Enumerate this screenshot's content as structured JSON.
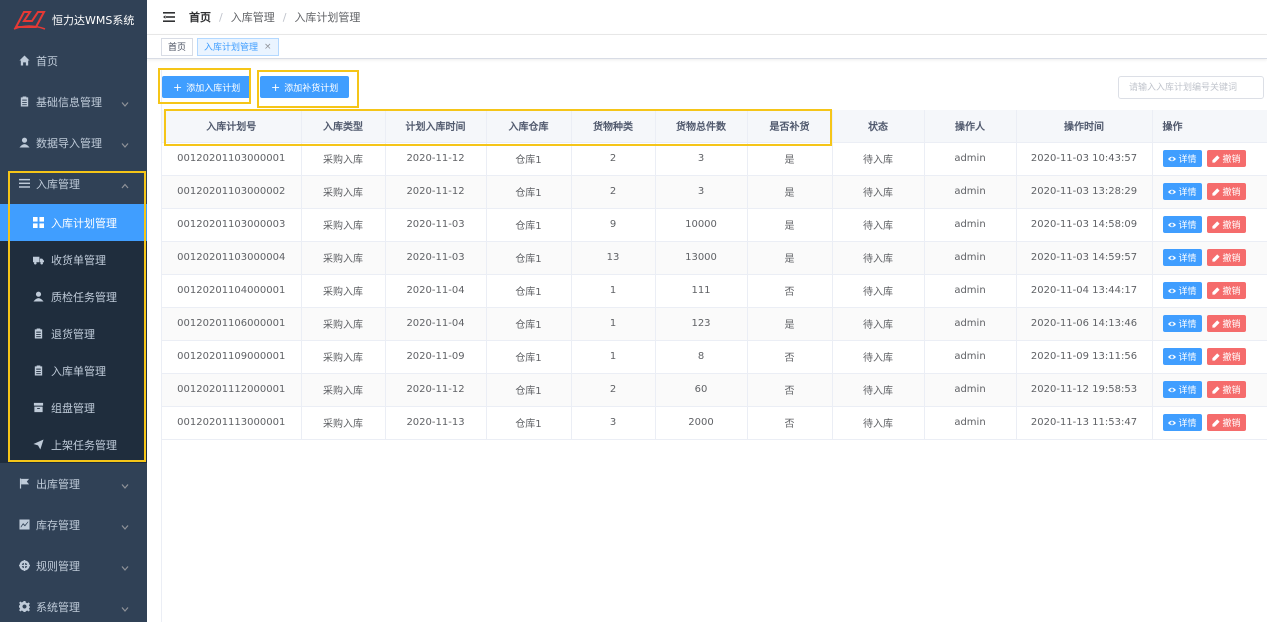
{
  "app": {
    "title": "恒力达WMS系统"
  },
  "sidebar": {
    "items_top": [
      {
        "label": "首页",
        "icon": "home-icon"
      },
      {
        "label": "基础信息管理",
        "icon": "clipboard-icon"
      },
      {
        "label": "数据导入管理",
        "icon": "user-icon"
      }
    ],
    "group": {
      "label": "入库管理",
      "icon": "list-icon",
      "children": [
        {
          "label": "入库计划管理",
          "icon": "grid-icon"
        },
        {
          "label": "收货单管理",
          "icon": "truck-icon"
        },
        {
          "label": "质检任务管理",
          "icon": "user-icon"
        },
        {
          "label": "退货管理",
          "icon": "clipboard-icon"
        },
        {
          "label": "入库单管理",
          "icon": "clipboard-icon"
        },
        {
          "label": "组盘管理",
          "icon": "box-icon"
        },
        {
          "label": "上架任务管理",
          "icon": "send-icon"
        }
      ]
    },
    "items_bottom": [
      {
        "label": "出库管理",
        "icon": "flag-icon"
      },
      {
        "label": "库存管理",
        "icon": "chart-icon"
      },
      {
        "label": "规则管理",
        "icon": "target-icon"
      },
      {
        "label": "系统管理",
        "icon": "gear-icon"
      }
    ]
  },
  "breadcrumb": [
    "首页",
    "入库管理",
    "入库计划管理"
  ],
  "tags": [
    {
      "label": "首页"
    },
    {
      "label": "入库计划管理",
      "close": "×"
    }
  ],
  "toolbar": {
    "add_plan": "添加入库计划",
    "add_replenish": "添加补货计划",
    "search_placeholder": "请输入入库计划编号关键词"
  },
  "table": {
    "headers": [
      "入库计划号",
      "入库类型",
      "计划入库时间",
      "入库仓库",
      "货物种类",
      "货物总件数",
      "是否补货",
      "状态",
      "操作人",
      "操作时间",
      "操作"
    ],
    "detail_label": "详情",
    "cancel_label": "撤销",
    "rows": [
      [
        "00120201103000001",
        "采购入库",
        "2020-11-12",
        "仓库1",
        "2",
        "3",
        "是",
        "待入库",
        "admin",
        "2020-11-03 10:43:57"
      ],
      [
        "00120201103000002",
        "采购入库",
        "2020-11-12",
        "仓库1",
        "2",
        "3",
        "是",
        "待入库",
        "admin",
        "2020-11-03 13:28:29"
      ],
      [
        "00120201103000003",
        "采购入库",
        "2020-11-03",
        "仓库1",
        "9",
        "10000",
        "是",
        "待入库",
        "admin",
        "2020-11-03 14:58:09"
      ],
      [
        "00120201103000004",
        "采购入库",
        "2020-11-03",
        "仓库1",
        "13",
        "13000",
        "是",
        "待入库",
        "admin",
        "2020-11-03 14:59:57"
      ],
      [
        "00120201104000001",
        "采购入库",
        "2020-11-04",
        "仓库1",
        "1",
        "111",
        "否",
        "待入库",
        "admin",
        "2020-11-04 13:44:17"
      ],
      [
        "00120201106000001",
        "采购入库",
        "2020-11-04",
        "仓库1",
        "1",
        "123",
        "是",
        "待入库",
        "admin",
        "2020-11-06 14:13:46"
      ],
      [
        "00120201109000001",
        "采购入库",
        "2020-11-09",
        "仓库1",
        "1",
        "8",
        "否",
        "待入库",
        "admin",
        "2020-11-09 13:11:56"
      ],
      [
        "00120201112000001",
        "采购入库",
        "2020-11-12",
        "仓库1",
        "2",
        "60",
        "否",
        "待入库",
        "admin",
        "2020-11-12 19:58:53"
      ],
      [
        "00120201113000001",
        "采购入库",
        "2020-11-13",
        "仓库1",
        "3",
        "2000",
        "否",
        "待入库",
        "admin",
        "2020-11-13 11:53:47"
      ]
    ]
  },
  "colors": {
    "sidebar": "#304156",
    "primary": "#409eff",
    "danger": "#f56c6c",
    "highlight": "#f5c518"
  }
}
